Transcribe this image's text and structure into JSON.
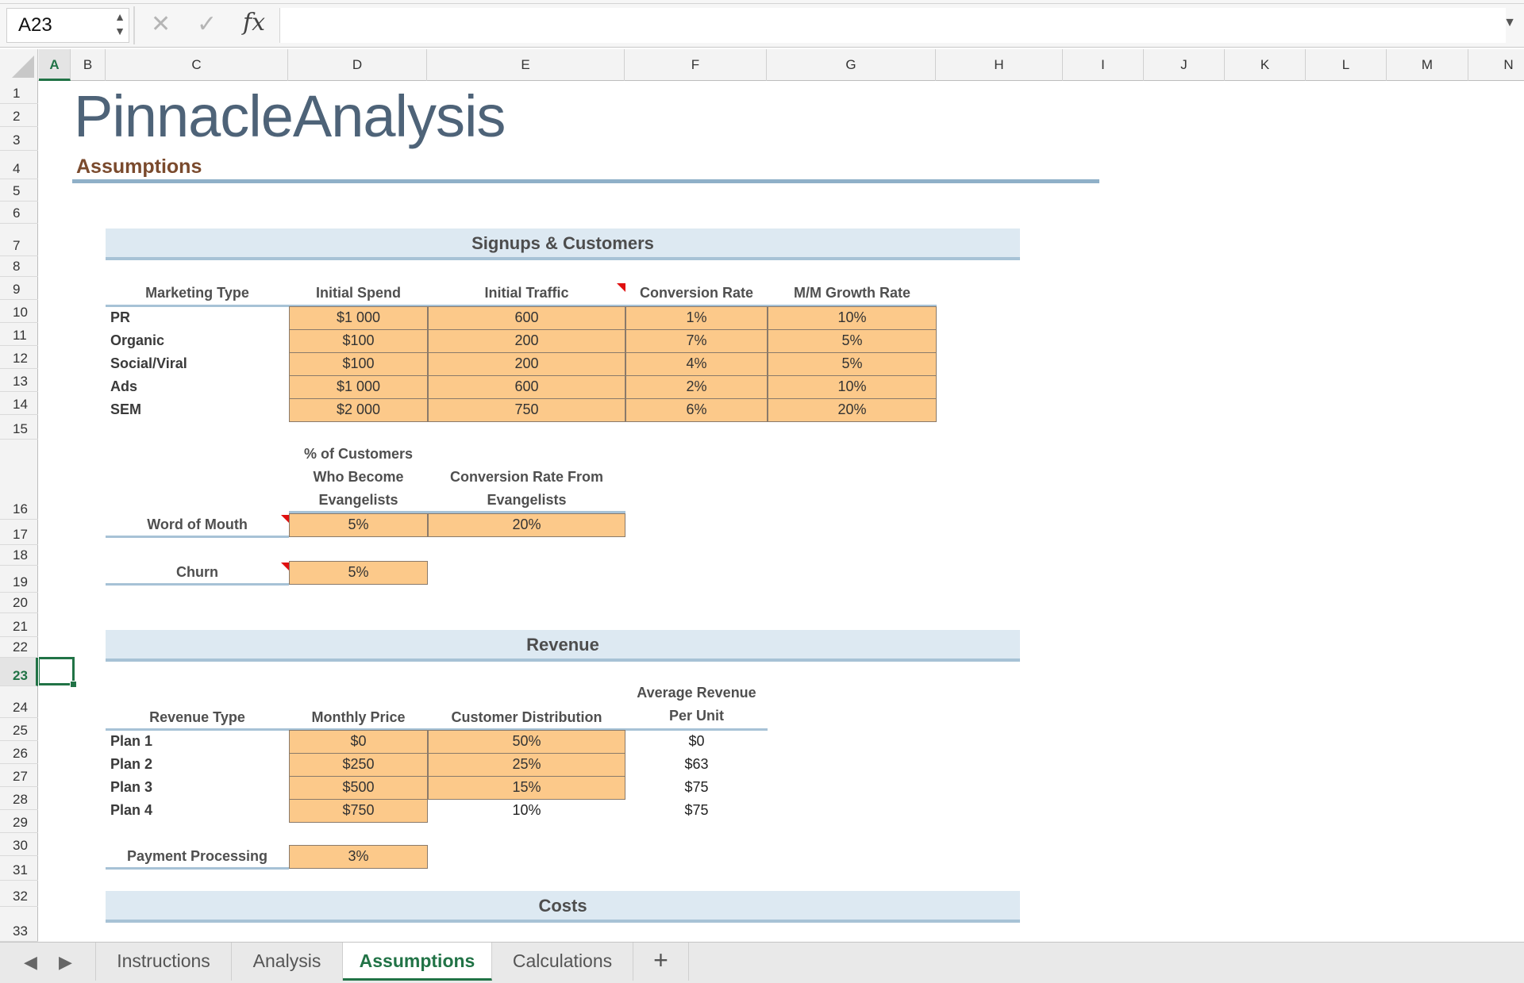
{
  "formula_bar": {
    "name_box": "A23",
    "fx_label": "fx",
    "formula_value": ""
  },
  "columns": [
    "A",
    "B",
    "C",
    "D",
    "E",
    "F",
    "G",
    "H",
    "I",
    "J",
    "K",
    "L",
    "M",
    "N"
  ],
  "active_column": "A",
  "rows": [
    "1",
    "2",
    "3",
    "4",
    "5",
    "6",
    "7",
    "8",
    "9",
    "10",
    "11",
    "12",
    "13",
    "14",
    "15",
    "16",
    "17",
    "18",
    "19",
    "20",
    "21",
    "22",
    "23",
    "24",
    "25",
    "26",
    "27",
    "28",
    "29",
    "30",
    "31",
    "32",
    "33"
  ],
  "active_row": "23",
  "logo": "PinnacleAnalysis",
  "page_heading": "Assumptions",
  "signups": {
    "section_title": "Signups & Customers",
    "headers": [
      "Marketing Type",
      "Initial Spend",
      "Initial Traffic",
      "Conversion Rate",
      "M/M Growth Rate"
    ],
    "rows": [
      {
        "type": "PR",
        "spend": "$1 000",
        "traffic": "600",
        "conversion": "1%",
        "growth": "10%"
      },
      {
        "type": "Organic",
        "spend": "$100",
        "traffic": "200",
        "conversion": "7%",
        "growth": "5%"
      },
      {
        "type": "Social/Viral",
        "spend": "$100",
        "traffic": "200",
        "conversion": "4%",
        "growth": "5%"
      },
      {
        "type": "Ads",
        "spend": "$1 000",
        "traffic": "600",
        "conversion": "2%",
        "growth": "10%"
      },
      {
        "type": "SEM",
        "spend": "$2 000",
        "traffic": "750",
        "conversion": "6%",
        "growth": "20%"
      }
    ],
    "wom_header_1": [
      "% of Customers",
      "Who Become",
      "Evangelists"
    ],
    "wom_header_2": [
      "Conversion Rate From",
      "Evangelists"
    ],
    "wom_label": "Word of Mouth",
    "wom_pct": "5%",
    "wom_conv": "20%",
    "churn_label": "Churn",
    "churn_value": "5%"
  },
  "revenue": {
    "section_title": "Revenue",
    "headers": [
      "Revenue Type",
      "Monthly Price",
      "Customer Distribution"
    ],
    "arpu_header": [
      "Average Revenue",
      "Per Unit"
    ],
    "rows": [
      {
        "type": "Plan 1",
        "price": "$0",
        "dist": "50%",
        "arpu": "$0"
      },
      {
        "type": "Plan 2",
        "price": "$250",
        "dist": "25%",
        "arpu": "$63"
      },
      {
        "type": "Plan 3",
        "price": "$500",
        "dist": "15%",
        "arpu": "$75"
      },
      {
        "type": "Plan 4",
        "price": "$750",
        "dist": "10%",
        "arpu": "$75"
      }
    ],
    "processing_label": "Payment Processing",
    "processing_value": "3%"
  },
  "costs": {
    "section_title": "Costs"
  },
  "tabs": [
    "Instructions",
    "Analysis",
    "Assumptions",
    "Calculations"
  ],
  "active_tab": "Assumptions",
  "add_tab": "+",
  "colors": {
    "accent": "#217346",
    "input_fill": "#fcc98a",
    "band_fill": "#dde9f2",
    "heading_brown": "#7a4a2d",
    "logo_slate": "#4e6378"
  }
}
